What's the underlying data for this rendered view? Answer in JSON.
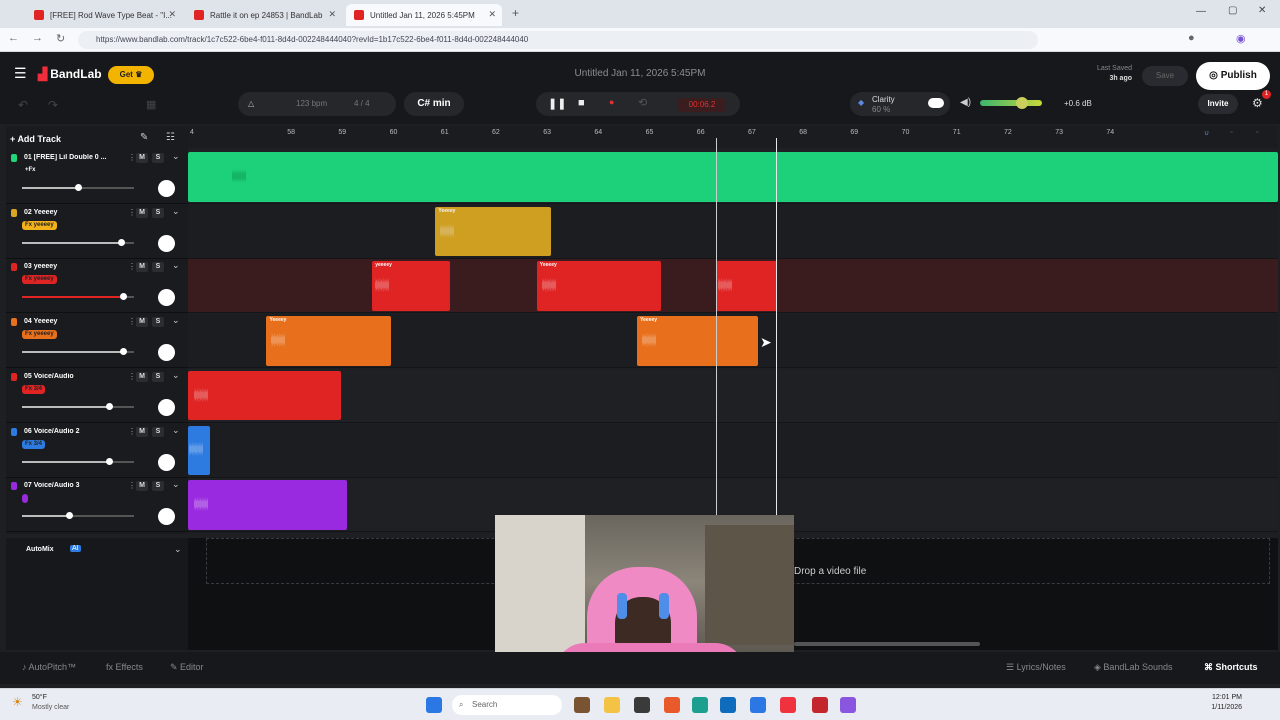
{
  "browser": {
    "tabs": [
      {
        "label": "[FREE] Rod Wave Type Beat - \"I...",
        "active": false
      },
      {
        "label": "Rattle it on ep 24853 | BandLab",
        "active": false
      },
      {
        "label": "Untitled Jan 11, 2026 5:45PM",
        "active": true
      }
    ],
    "url": "https://www.bandlab.com/track/1c7c522-6be4-f011-8d4d-002248444040?revId=1b17c522-6be4-f011-8d4d-002248444040"
  },
  "app": {
    "logo": "BandLab",
    "get_label": "Get",
    "project_title": "Untitled Jan 11, 2026 5:45PM",
    "last_saved_label": "Last Saved",
    "last_saved_time": "3h ago",
    "save_label": "Save",
    "publish_label": "Publish",
    "tempo": "123 bpm",
    "time_sig": "4 / 4",
    "key": "C# min",
    "time_display": "00:06.2",
    "clarity_label": "Clarity",
    "clarity_value": "60 %",
    "master_db": "+0.6 dB",
    "invite_label": "Invite",
    "add_track_label": "Add Track",
    "notification_count": "1"
  },
  "ruler_ticks": [
    "4",
    "58",
    "59",
    "60",
    "61",
    "62",
    "63",
    "64",
    "65",
    "66",
    "67",
    "68",
    "69",
    "70",
    "71",
    "72",
    "73",
    "74"
  ],
  "tracks": [
    {
      "name": "01 [FREE] Lil Double 0 ...",
      "fx": "+Fx",
      "color": "#1fd67a",
      "fxcolor": "",
      "volume": 0.5
    },
    {
      "name": "02 Yeeeey",
      "fx": "Fx yeeeey",
      "color": "#d9a623",
      "fxcolor": "#f2b21b",
      "volume": 0.88
    },
    {
      "name": "03 yeeeey",
      "fx": "Fx yeeeey",
      "color": "#e02424",
      "fxcolor": "#e02424",
      "volume": 0.9
    },
    {
      "name": "04 Yeeeey",
      "fx": "Fx yeeeey",
      "color": "#e8701c",
      "fxcolor": "#e8701c",
      "volume": 0.9
    },
    {
      "name": "05 Voice/Audio",
      "fx": "Fx 3/4",
      "color": "#e02424",
      "fxcolor": "#e02424",
      "volume": 0.78
    },
    {
      "name": "06 Voice/Audio 2",
      "fx": "Fx 3/4",
      "color": "#2d7be0",
      "fxcolor": "#2d7be0",
      "volume": 0.78
    },
    {
      "name": "07 Voice/Audio 3",
      "fx": "",
      "color": "#9a2ae0",
      "fxcolor": "#9a2ae0",
      "volume": 0.42
    }
  ],
  "clips": [
    {
      "track": 0,
      "label": "",
      "start": 0.0,
      "end": 1.0
    },
    {
      "track": 1,
      "label": "Yeeeey",
      "start": 0.227,
      "end": 0.333
    },
    {
      "track": 2,
      "label": "yeeeey",
      "start": 0.169,
      "end": 0.24
    },
    {
      "track": 2,
      "label": "Yeeeey",
      "start": 0.32,
      "end": 0.434
    },
    {
      "track": 2,
      "label": "",
      "start": 0.484,
      "end": 0.54
    },
    {
      "track": 3,
      "label": "Yeeeey",
      "start": 0.072,
      "end": 0.186
    },
    {
      "track": 3,
      "label": "Yeeeey",
      "start": 0.412,
      "end": 0.523
    },
    {
      "track": 4,
      "label": "",
      "start": 0.0,
      "end": 0.14
    },
    {
      "track": 5,
      "label": "",
      "start": 0.0,
      "end": 0.02
    },
    {
      "track": 6,
      "label": "",
      "start": 0.0,
      "end": 0.146
    }
  ],
  "lower": {
    "automix_label": "AutoMix",
    "drop_video_label": "Drop a video file"
  },
  "bottom": {
    "autopitch": "AutoPitch™",
    "effects": "Effects",
    "editor": "Editor",
    "lyrics": "Lyrics/Notes",
    "sounds": "BandLab Sounds",
    "shortcuts": "Shortcuts"
  },
  "taskbar": {
    "weather_temp": "50°F",
    "weather_desc": "Mostly clear",
    "search_placeholder": "Search",
    "time": "12:01 PM",
    "date": "1/11/2026"
  }
}
